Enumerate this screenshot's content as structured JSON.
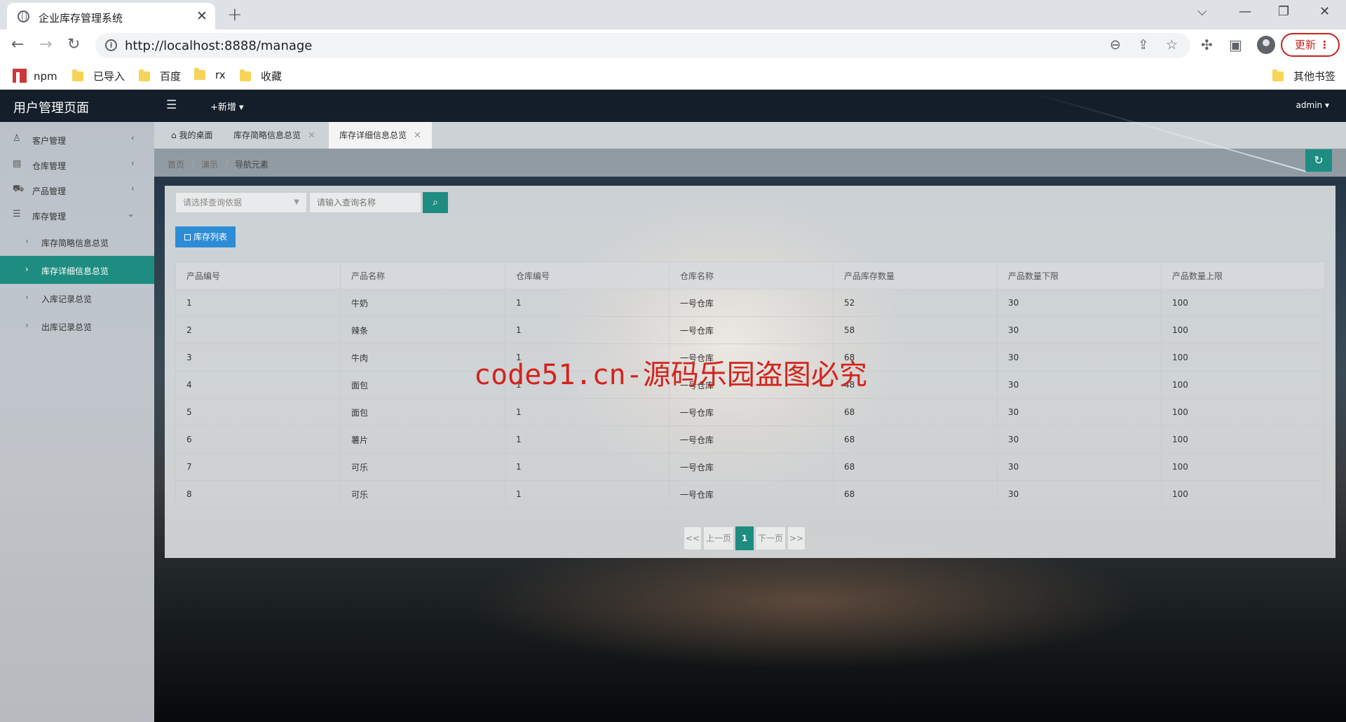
{
  "browser": {
    "tab_title": "企业库存管理系统",
    "url": "http://localhost:8888/manage",
    "update_label": "更新",
    "bookmarks": [
      "npm",
      "已导入",
      "百度",
      "rx",
      "收藏"
    ],
    "other_bookmarks": "其他书签"
  },
  "header": {
    "title": "用户管理页面",
    "add_new": "+新增",
    "user": "admin"
  },
  "sidebar": {
    "items": [
      {
        "label": "客户管理",
        "icon": "user-icon"
      },
      {
        "label": "仓库管理",
        "icon": "warehouse-icon"
      },
      {
        "label": "产品管理",
        "icon": "cart-icon"
      },
      {
        "label": "库存管理",
        "icon": "database-icon"
      }
    ],
    "subitems": [
      {
        "label": "库存简略信息总览"
      },
      {
        "label": "库存详细信息总览"
      },
      {
        "label": "入库记录总览"
      },
      {
        "label": "出库记录总览"
      }
    ]
  },
  "page_tabs": [
    {
      "label": "我的桌面"
    },
    {
      "label": "库存简略信息总览"
    },
    {
      "label": "库存详细信息总览"
    }
  ],
  "breadcrumb": [
    "首页",
    "演示",
    "导航元素"
  ],
  "search": {
    "select_placeholder": "请选择查询依据",
    "input_placeholder": "请输入查询名称",
    "list_button": "库存列表"
  },
  "table": {
    "headers": [
      "产品编号",
      "产品名称",
      "仓库编号",
      "仓库名称",
      "产品库存数量",
      "产品数量下限",
      "产品数量上限"
    ],
    "rows": [
      [
        "1",
        "牛奶",
        "1",
        "一号仓库",
        "52",
        "30",
        "100"
      ],
      [
        "2",
        "辣条",
        "1",
        "一号仓库",
        "58",
        "30",
        "100"
      ],
      [
        "3",
        "牛肉",
        "1",
        "一号仓库",
        "68",
        "30",
        "100"
      ],
      [
        "4",
        "面包",
        "1",
        "一号仓库",
        "48",
        "30",
        "100"
      ],
      [
        "5",
        "面包",
        "1",
        "一号仓库",
        "68",
        "30",
        "100"
      ],
      [
        "6",
        "薯片",
        "1",
        "一号仓库",
        "68",
        "30",
        "100"
      ],
      [
        "7",
        "可乐",
        "1",
        "一号仓库",
        "68",
        "30",
        "100"
      ],
      [
        "8",
        "可乐",
        "1",
        "一号仓库",
        "68",
        "30",
        "100"
      ]
    ]
  },
  "pagination": {
    "first": "<<",
    "prev": "上一页",
    "current": "1",
    "next": "下一页",
    "last": ">>"
  },
  "watermark": "code51.cn-源码乐园盗图必究",
  "colors": {
    "accent": "#1e8c81",
    "list_button": "#2d8cd6",
    "watermark": "#d4231d"
  }
}
